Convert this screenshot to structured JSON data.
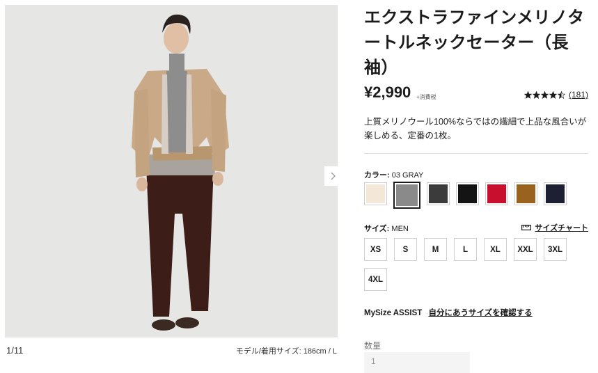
{
  "gallery": {
    "counter": "1/11",
    "model_size": "モデル/着用サイズ: 186cm / L",
    "next_icon": "chevron-right-icon"
  },
  "product": {
    "title": "エクストラファインメリノタートルネックセーター（長袖）",
    "price": "¥2,990",
    "tax_note": "+消費税",
    "rating_value": 4.5,
    "review_count": "(181)",
    "description": "上質メリノウール100%ならではの繊細で上品な風合いが楽しめる、定番の1枚。"
  },
  "color": {
    "label": "カラー:",
    "selected_name": "03 GRAY",
    "selected_index": 1,
    "swatches": [
      {
        "name": "off-white",
        "hex": "#f3e7d8"
      },
      {
        "name": "gray",
        "hex": "#8a8a8a"
      },
      {
        "name": "dark-gray",
        "hex": "#3b3b3b"
      },
      {
        "name": "black",
        "hex": "#141414"
      },
      {
        "name": "red",
        "hex": "#c8102e"
      },
      {
        "name": "brown",
        "hex": "#9a621f"
      },
      {
        "name": "navy",
        "hex": "#1d2033"
      }
    ]
  },
  "size": {
    "label": "サイズ:",
    "gender": "MEN",
    "chart_link": "サイズチャート",
    "chart_icon": "ruler-icon",
    "options": [
      "XS",
      "S",
      "M",
      "L",
      "XL",
      "XXL",
      "3XL",
      "4XL"
    ]
  },
  "mysize": {
    "label": "MySize ASSIST",
    "link": "自分にあうサイズを確認する"
  },
  "quantity": {
    "label": "数量",
    "value": "1"
  }
}
